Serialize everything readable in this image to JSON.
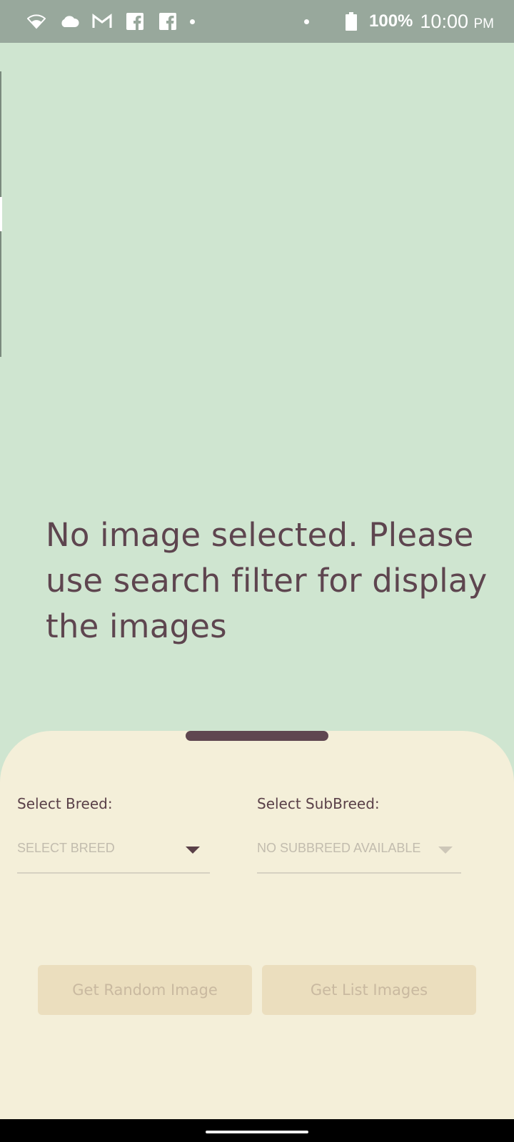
{
  "status_bar": {
    "battery": "100%",
    "time": "10:00",
    "ampm": "PM",
    "icons": [
      "wifi-icon",
      "cloud-icon",
      "gmail-icon",
      "facebook-icon",
      "facebook-icon",
      "dot-icon",
      "dot-icon",
      "battery-icon"
    ]
  },
  "main": {
    "empty_message": "No image selected. Please use search filter for display the images"
  },
  "bottom_sheet": {
    "breed_label": "Select Breed:",
    "breed_placeholder": "SELECT BREED",
    "subbreed_label": "Select SubBreed:",
    "subbreed_placeholder": "NO SUBBREED AVAILABLE",
    "random_button": "Get Random Image",
    "list_button": "Get List Images"
  },
  "colors": {
    "background": "#cfe5d0",
    "sheet": "#f4efd9",
    "text": "#5e454f",
    "button": "#ebdebe",
    "status_bar": "#98a89c"
  }
}
